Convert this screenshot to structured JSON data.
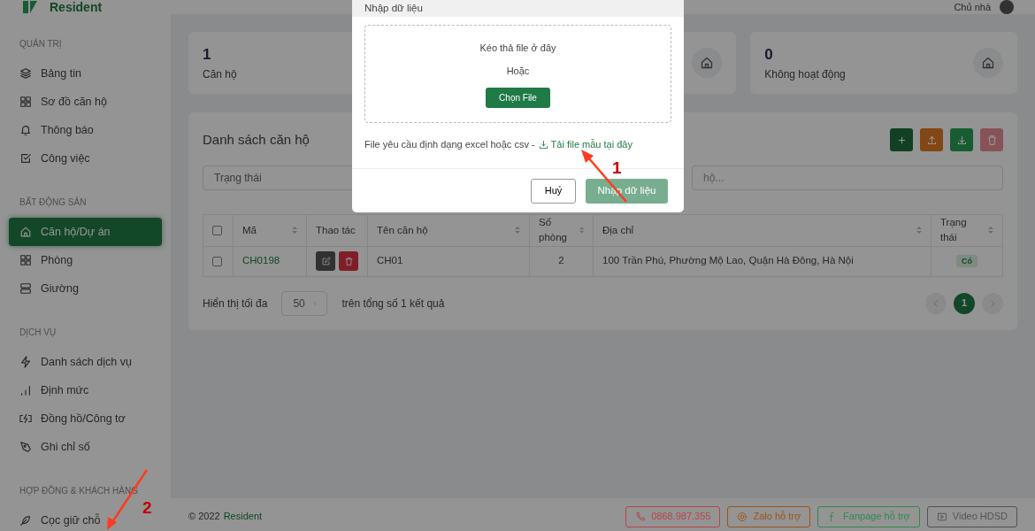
{
  "topbar": {
    "logo": "Resident",
    "user": "Chủ nhà"
  },
  "sidebar": {
    "sections": [
      {
        "title": "QUẢN TRỊ",
        "items": [
          {
            "label": "Bảng tin",
            "selected": false
          },
          {
            "label": "Sơ đồ căn hộ",
            "selected": false
          },
          {
            "label": "Thông báo",
            "selected": false
          },
          {
            "label": "Công việc",
            "selected": false
          }
        ]
      },
      {
        "title": "BẤT ĐỘNG SẢN",
        "items": [
          {
            "label": "Căn hộ/Dự án",
            "selected": true
          },
          {
            "label": "Phòng",
            "selected": false
          },
          {
            "label": "Giường",
            "selected": false
          }
        ]
      },
      {
        "title": "DỊCH VỤ",
        "items": [
          {
            "label": "Danh sách dịch vụ",
            "selected": false
          },
          {
            "label": "Định mức",
            "selected": false
          },
          {
            "label": "Đồng hồ/Công tơ",
            "selected": false
          },
          {
            "label": "Ghi chỉ số",
            "selected": false
          }
        ]
      },
      {
        "title": "HỢP ĐỒNG & KHÁCH HÀNG",
        "items": [
          {
            "label": "Cọc giữ chỗ",
            "selected": false
          }
        ]
      }
    ]
  },
  "stats": [
    {
      "value": "1",
      "label": "Căn hộ"
    },
    {
      "value": "0",
      "label": "Không hoạt động"
    }
  ],
  "panel": {
    "title": "Danh sách căn hộ",
    "actions": [
      {
        "kind": "add",
        "disabled": false
      },
      {
        "kind": "upload",
        "disabled": false
      },
      {
        "kind": "download",
        "disabled": false
      },
      {
        "kind": "delete",
        "disabled": true
      }
    ],
    "filter": {
      "placeholder": "Trạng thái"
    },
    "search": {
      "placeholder": "hộ..."
    },
    "table": {
      "select_all_checked": false,
      "columns": [
        "Mã",
        "Thao tác",
        "Tên căn hộ",
        "Số phòng",
        "Địa chỉ",
        "Trạng thái"
      ],
      "rows": [
        {
          "checked": false,
          "code": "CH0198",
          "name": "CH01",
          "rooms": "2",
          "address": "100 Trần Phú, Phường Mộ Lao, Quận Hà Đông, Hà Nội",
          "status": "Có"
        }
      ]
    },
    "page_size_label": "Hiển thị tối đa",
    "page_size": "50",
    "total": "trên tổng số 1 kết quả",
    "pages": [
      {
        "label": "1",
        "selected": true
      }
    ]
  },
  "footer": {
    "copyright": "© 2022",
    "brand": "Resident",
    "buttons": [
      {
        "kind": "phone",
        "label": "0868.987.355",
        "color": "#b8444a"
      },
      {
        "kind": "zalo",
        "label": "Zalo hỗ trợ",
        "color": "#9a5418"
      },
      {
        "kind": "fanpage",
        "label": "Fanpage hỗ trợ",
        "color": "#2f8a50"
      },
      {
        "kind": "video",
        "label": "Video HDSD",
        "color": "#505356"
      }
    ]
  },
  "modal": {
    "title": "Nhập dữ liệu",
    "drop_text": "Kéo thả file ở đây",
    "or_text": "Hoặc",
    "choose_button": "Chọn File",
    "hint": "File yêu cầu định dạng excel hoặc csv -",
    "template_link": "Tải file mẫu tại đây",
    "cancel_button": "Huỷ",
    "submit_button": {
      "label": "Nhập dữ liệu",
      "disabled": true
    }
  },
  "annotations": [
    "1",
    "2"
  ]
}
